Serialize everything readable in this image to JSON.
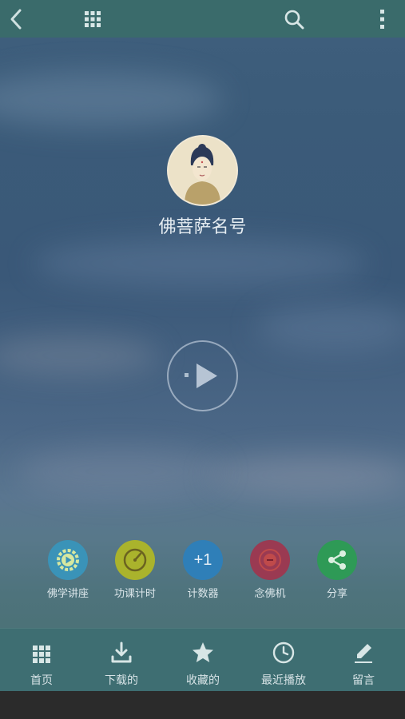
{
  "header": {
    "back_icon": "back-arrow-icon",
    "menu_icon": "grid-icon",
    "search_icon": "search-icon",
    "more_icon": "more-vertical-icon",
    "background_color": "#3a6b6b"
  },
  "main": {
    "title": "佛菩萨名号",
    "play_icon": "play-icon"
  },
  "shortcuts": [
    {
      "label": "佛学讲座",
      "icon": "gear-play-icon",
      "color": "#3a93b8"
    },
    {
      "label": "功课计时",
      "icon": "gauge-icon",
      "color": "#aab32c"
    },
    {
      "label": "计数器",
      "icon": "plus-one-icon",
      "color": "#2f7fb8",
      "glyph": "+1"
    },
    {
      "label": "念佛机",
      "icon": "record-icon",
      "color": "#9a3a52"
    },
    {
      "label": "分享",
      "icon": "share-icon",
      "color": "#2e9a56"
    }
  ],
  "bottom_nav": [
    {
      "label": "首页",
      "icon": "grid-icon"
    },
    {
      "label": "下载的",
      "icon": "download-icon"
    },
    {
      "label": "收藏的",
      "icon": "star-icon"
    },
    {
      "label": "最近播放",
      "icon": "clock-icon"
    },
    {
      "label": "留言",
      "icon": "pencil-icon"
    }
  ]
}
